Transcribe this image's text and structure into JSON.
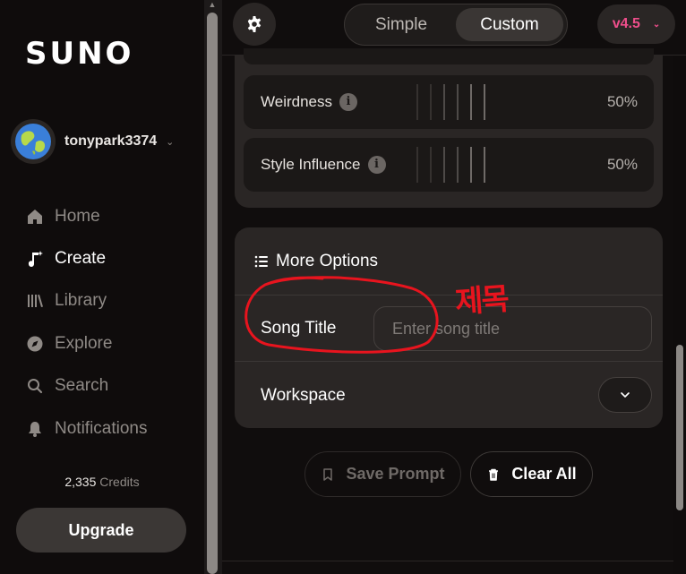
{
  "sidebar": {
    "logo": "SUNO",
    "username": "tonypark3374",
    "nav": [
      {
        "label": "Home",
        "icon": "home-icon",
        "active": false
      },
      {
        "label": "Create",
        "icon": "create-icon",
        "active": true
      },
      {
        "label": "Library",
        "icon": "library-icon",
        "active": false
      },
      {
        "label": "Explore",
        "icon": "compass-icon",
        "active": false
      },
      {
        "label": "Search",
        "icon": "search-icon",
        "active": false
      },
      {
        "label": "Notifications",
        "icon": "bell-icon",
        "active": false
      }
    ],
    "credits_value": "2,335",
    "credits_label": "Credits",
    "upgrade_label": "Upgrade"
  },
  "topbar": {
    "mode_simple": "Simple",
    "mode_custom": "Custom",
    "active_mode": "Custom",
    "version": "v4.5"
  },
  "sliders": [
    {
      "label": "Weirdness",
      "value": "50%",
      "fraction": 0.5
    },
    {
      "label": "Style Influence",
      "value": "50%",
      "fraction": 0.5
    }
  ],
  "options": {
    "heading": "More Options",
    "song_title_label": "Song Title",
    "song_title_placeholder": "Enter song title",
    "song_title_value": "",
    "workspace_label": "Workspace"
  },
  "actions": {
    "save_prompt": "Save Prompt",
    "clear_all": "Clear All"
  },
  "annotation": {
    "text": "제목",
    "color": "#e8141e"
  },
  "colors": {
    "accent": "#e0408a",
    "version": "#ee4e8b",
    "panel": "#2a2625"
  }
}
